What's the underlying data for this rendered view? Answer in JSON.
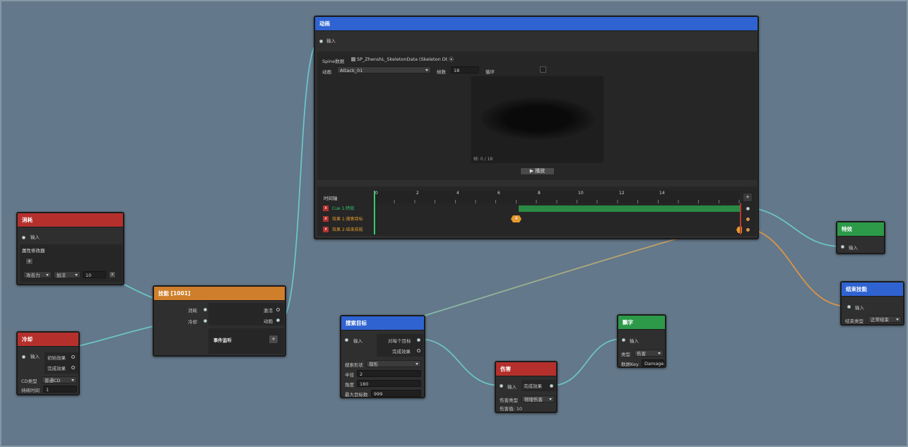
{
  "nodes": {
    "anim": {
      "title": "动画",
      "input": "输入",
      "spine_label": "Spine数据",
      "spine_value": "SP_ZhenshL_SkeletonData (Skeleton Dt",
      "anim_label": "动画",
      "anim_value": "Attack_01",
      "frames_label": "帧数",
      "frames_value": "18",
      "loop_label": "循环",
      "frame_counter": "帧: 0 / 18",
      "play_label": "▶ 播放",
      "timeline_label": "时间轴",
      "add_label": "+",
      "ticks": [
        "0",
        "2",
        "4",
        "6",
        "8",
        "10",
        "12",
        "14"
      ],
      "tracks": [
        {
          "remove": "x",
          "label": "Cue 1:特效",
          "color": "#2ecc71"
        },
        {
          "remove": "x",
          "label": "效果 1:搜索目标",
          "color": "#e39a2e"
        },
        {
          "remove": "x",
          "label": "效果 2:结束技能",
          "color": "#e39a2e"
        }
      ],
      "marker_label": "4"
    },
    "consume": {
      "title": "消耗",
      "input": "输入",
      "section": "属性修改器",
      "add": "+",
      "attr_value": "攻击力",
      "op_value": "加法",
      "num_value": "10",
      "remove": "x"
    },
    "cooldown": {
      "title": "冷却",
      "input": "输入",
      "start_effect": "初始效果",
      "done_effect": "完成效果",
      "cd_type_label": "CD类型",
      "cd_type_value": "普通CD",
      "duration_label": "持续时间",
      "duration_value": "1"
    },
    "skill": {
      "title": "技能 [1001]",
      "consume_port": "消耗",
      "cooldown_port": "冷却",
      "activate_port": "激活",
      "anim_port": "动画",
      "event_label": "事件监听",
      "event_add": "+"
    },
    "search": {
      "title": "搜索目标",
      "input": "输入",
      "each_target": "对每个目标",
      "done_effect": "完成效果",
      "shape_label": "搜索形状",
      "shape_value": "扇形",
      "radius_label": "半径",
      "radius_value": "2",
      "angle_label": "角度",
      "angle_value": "180",
      "max_label": "最大目标数",
      "max_value": "999"
    },
    "damage": {
      "title": "伤害",
      "input": "输入",
      "done_effect": "完成效果",
      "type_label": "伤害类型",
      "type_value": "物理伤害",
      "value_text": "伤害值: 10"
    },
    "float": {
      "title": "飘字",
      "input": "输入",
      "type_label": "类型",
      "type_value": "伤害",
      "key_label": "数据Key",
      "key_value": "Damage"
    },
    "fx": {
      "title": "特效",
      "input": "输入"
    },
    "end": {
      "title": "结束技能",
      "input": "输入",
      "type_label": "结束类型",
      "type_value": "正常结束"
    }
  },
  "colors": {
    "canvas": "#63788a",
    "wire_teal": "#6cc3c6",
    "wire_orange": "#d8954a",
    "header_red": "#b5302c",
    "header_orange": "#cf7f2c",
    "header_blue": "#2f63d1",
    "header_green": "#2c9a48",
    "timeline_bar": "#2a8a44"
  }
}
